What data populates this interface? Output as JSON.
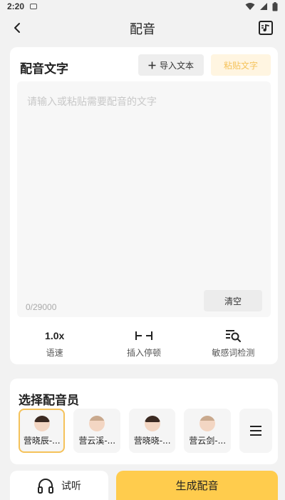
{
  "status": {
    "time": "2:20"
  },
  "header": {
    "title": "配音"
  },
  "text_card": {
    "label": "配音文字",
    "import_label": "导入文本",
    "paste_label": "粘贴文字",
    "placeholder": "请输入或粘贴需要配音的文字",
    "counter": "0/29000",
    "clear_label": "清空"
  },
  "tools": [
    {
      "value": "1.0x",
      "label": "语速",
      "icon": "speed-value"
    },
    {
      "label": "插入停顿",
      "icon": "pause-insert-icon"
    },
    {
      "label": "敏感词检测",
      "icon": "sensitive-search-icon"
    }
  ],
  "voice_card": {
    "label": "选择配音员",
    "voices": [
      {
        "name": "营晓辰-...",
        "gender": "female",
        "selected": true
      },
      {
        "name": "营云溪-...",
        "gender": "male",
        "selected": false
      },
      {
        "name": "营晓晓-...",
        "gender": "female",
        "selected": false
      },
      {
        "name": "营云剑-...",
        "gender": "male",
        "selected": false
      }
    ]
  },
  "actions": {
    "listen_label": "试听",
    "generate_label": "生成配音"
  },
  "colors": {
    "accent": "#ffcc4d",
    "accent_soft": "#fff5e1",
    "accent_text": "#f5c25a"
  }
}
